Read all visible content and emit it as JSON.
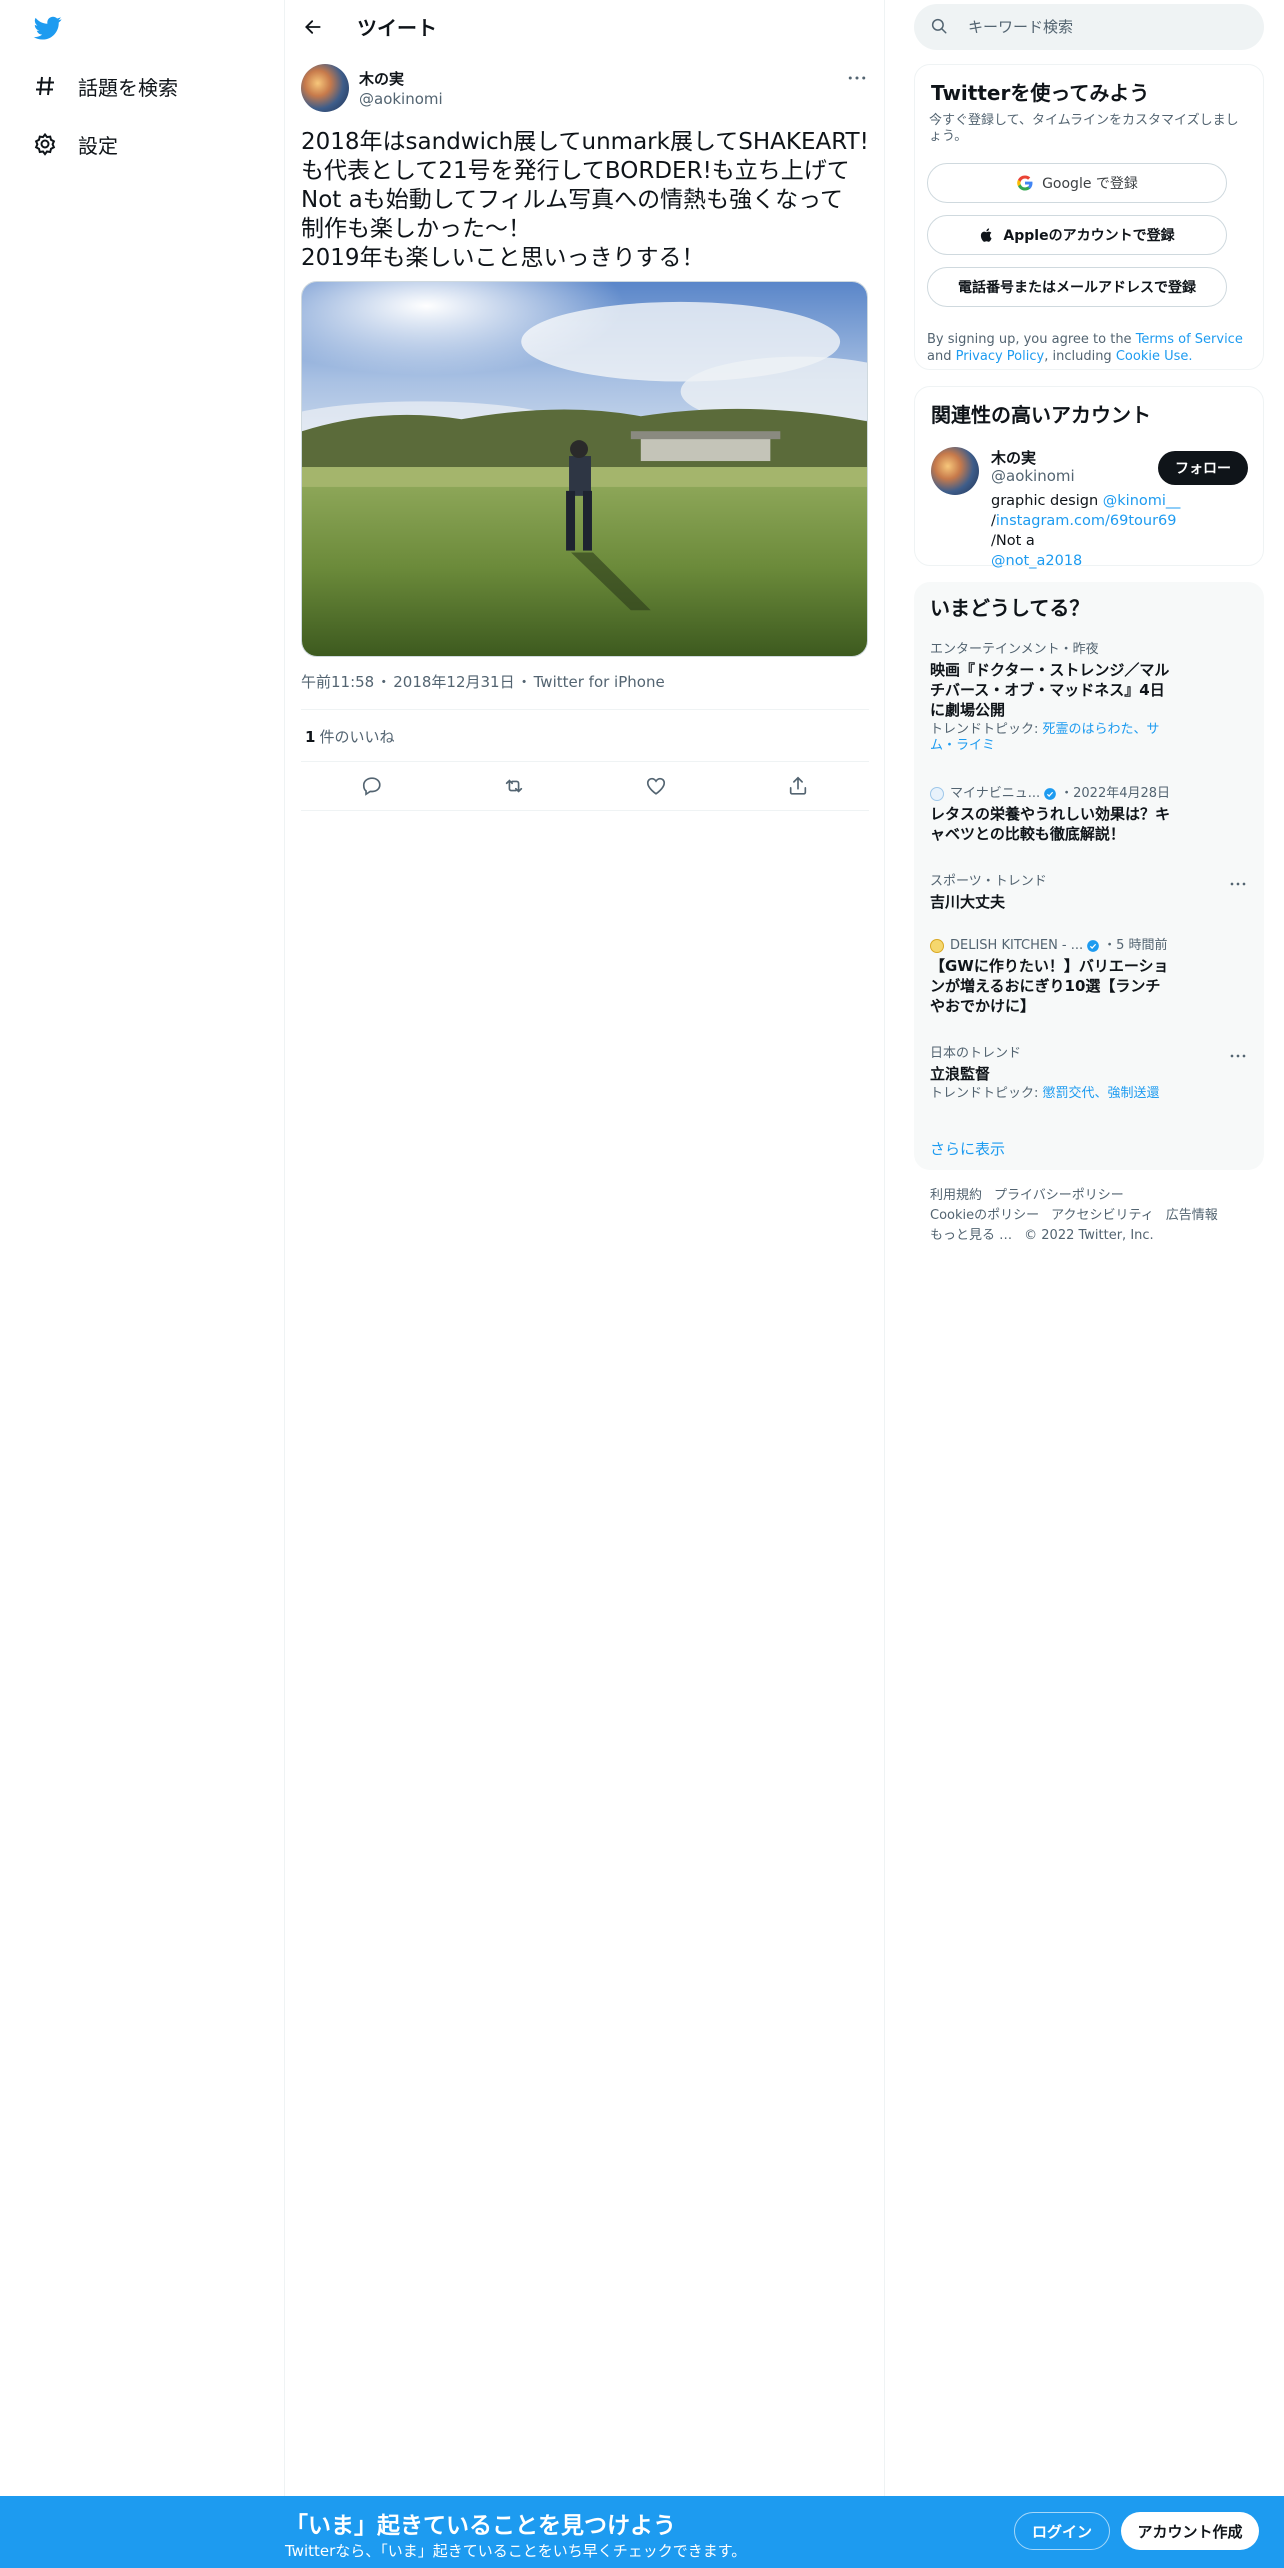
{
  "nav": {
    "logo": "twitter-bird-icon",
    "items": [
      {
        "label": "話題を検索",
        "icon": "hashtag-icon"
      },
      {
        "label": "設定",
        "icon": "gear-icon"
      }
    ]
  },
  "header": {
    "title": "ツイート"
  },
  "tweet": {
    "author_name": "木の実",
    "author_handle": "@aokinomi",
    "text": "2018年はsandwich展してunmark展してSHAKEART!\nも代表として21号を発行してBORDER!も立ち上げて\nNot aも始動してフィルム写真への情熱も強くなって\n制作も楽しかった〜！\n2019年も楽しいこと思いっきりする！",
    "time": "午前11:58",
    "date": "2018年12月31日",
    "source": "Twitter for iPhone",
    "like_count": "1",
    "like_label": "件のいいね"
  },
  "search": {
    "placeholder": "キーワード検索"
  },
  "signup": {
    "title": "Twitterを使ってみよう",
    "subtitle": "今すぐ登録して、タイムラインをカスタマイズしましょう。",
    "google": "Google で登録",
    "apple": "Appleのアカウントで登録",
    "phone": "電話番号またはメールアドレスで登録",
    "terms_1": "By signing up, you agree to the",
    "terms_tos": "Terms of Service",
    "terms_and": "and",
    "terms_privacy": "Privacy Policy",
    "terms_incl": ", including",
    "terms_cookie": "Cookie Use."
  },
  "related": {
    "title": "関連性の高いアカウント",
    "name": "木の実",
    "handle": "@aokinomi",
    "bio_1": "graphic design",
    "bio_link1": "@kinomi__",
    "bio_slash": "/",
    "bio_link2": "instagram.com/69tour69",
    "bio_2": " /Not a",
    "bio_link3": "@not_a2018",
    "follow": "フォロー"
  },
  "trends": {
    "title": "いまどうしてる？",
    "items": [
      {
        "meta": "エンターテインメント・昨夜",
        "title": "映画『ドクター・ストレンジ／マルチバース・オブ・マッドネス』4日に劇場公開",
        "topic_label": "トレンドトピック: ",
        "topic_links": "死霊のはらわた、サム・ライミ"
      },
      {
        "source": "マイナビニュ...",
        "time": "・2022年4月28日",
        "title": "レタスの栄養やうれしい効果は？キャベツとの比較も徹底解説！"
      },
      {
        "meta": "スポーツ・トレンド",
        "title": "吉川大丈夫"
      },
      {
        "source": "DELISH KITCHEN - ...",
        "time": "・5 時間前",
        "title": "【GWに作りたい！】バリエーションが増えるおにぎり10選【ランチやおでかけに】"
      },
      {
        "meta": "日本のトレンド",
        "title": "立浪監督",
        "topic_label": "トレンドトピック: ",
        "topic_links": "懲罰交代、強制送還"
      }
    ],
    "show_more": "さらに表示"
  },
  "footer": {
    "links": [
      "利用規約",
      "プライバシーポリシー",
      "Cookieのポリシー",
      "アクセシビリティ",
      "広告情報",
      "もっと見る …",
      "© 2022 Twitter, Inc."
    ]
  },
  "bottom_bar": {
    "title": "「いま」起きていることを見つけよう",
    "subtitle": "Twitterなら、「いま」起きていることをいち早くチェックできます。",
    "login": "ログイン",
    "signup": "アカウント作成"
  },
  "colors": {
    "accent": "#1d9bf0",
    "text": "#0f1419",
    "muted": "#536471"
  }
}
